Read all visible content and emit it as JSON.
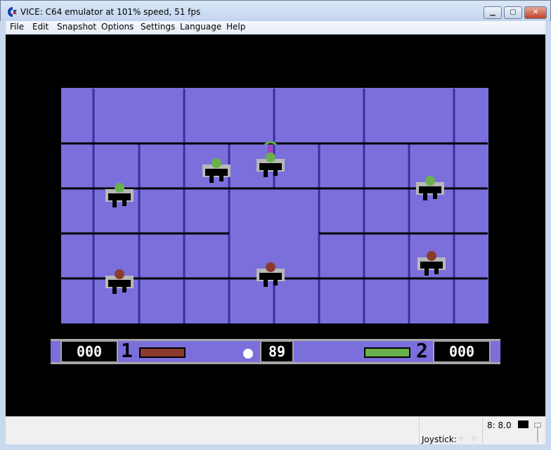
{
  "window": {
    "title": "VICE: C64 emulator at 101% speed, 51 fps",
    "icon": "commodore-logo-icon",
    "buttons": [
      "minimize",
      "maximize",
      "close"
    ]
  },
  "menu": [
    {
      "label": "File",
      "accel": "F"
    },
    {
      "label": "Edit",
      "accel": "E"
    },
    {
      "label": "Snapshot",
      "accel": "S"
    },
    {
      "label": "Options",
      "accel": "O"
    },
    {
      "label": "Settings",
      "accel": "t"
    },
    {
      "label": "Language",
      "accel": "L"
    },
    {
      "label": "Help",
      "accel": "H"
    }
  ],
  "game": {
    "colors": {
      "field": "#7b6fdc",
      "lines": "#3a2fa0",
      "border": "#000000",
      "team1": "#8b3a2e",
      "team2": "#6ab04c",
      "hud": "#7b6fdc"
    },
    "hud": {
      "score1": "000",
      "player1": "1",
      "timer": "89",
      "player2": "2",
      "score2": "000",
      "energy1": 1.0,
      "energy2": 1.0
    }
  },
  "status": {
    "drive": "8: 8.0",
    "joystick_label": "Joystick:",
    "joystick_icon": "joystick-indicator-icon"
  }
}
